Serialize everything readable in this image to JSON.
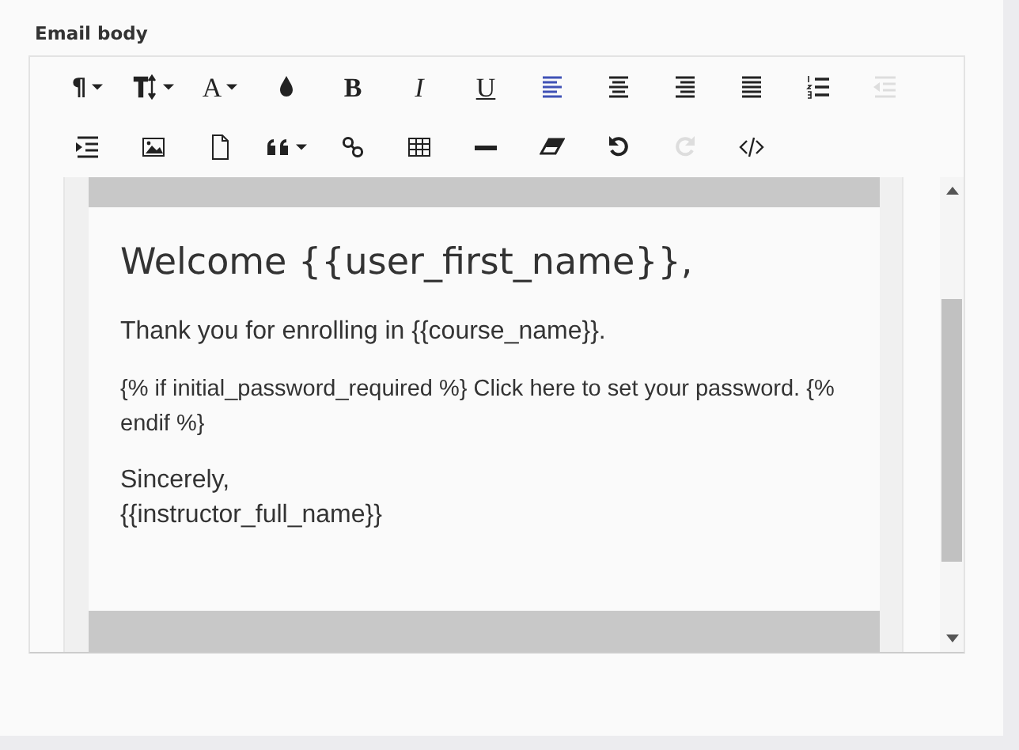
{
  "field": {
    "label": "Email body"
  },
  "toolbar": [
    [
      {
        "kind": "paragraph",
        "glyph": "¶",
        "dropdown": true,
        "selected": false,
        "disabled": false
      },
      {
        "kind": "font-size",
        "dropdown": true,
        "selected": false,
        "disabled": false
      },
      {
        "kind": "font-family",
        "glyph": "A",
        "dropdown": true,
        "selected": false,
        "disabled": false
      },
      {
        "kind": "color",
        "dropdown": false,
        "selected": false,
        "disabled": false
      },
      {
        "kind": "bold",
        "glyph": "B",
        "dropdown": false,
        "selected": false,
        "disabled": false
      },
      {
        "kind": "italic",
        "glyph": "I",
        "dropdown": false,
        "selected": false,
        "disabled": false
      },
      {
        "kind": "underline",
        "glyph": "U",
        "dropdown": false,
        "selected": false,
        "disabled": false
      },
      {
        "kind": "align-left",
        "dropdown": false,
        "selected": true,
        "disabled": false
      },
      {
        "kind": "align-center",
        "dropdown": false,
        "selected": false,
        "disabled": false
      },
      {
        "kind": "align-right",
        "dropdown": false,
        "selected": false,
        "disabled": false
      },
      {
        "kind": "justify",
        "dropdown": false,
        "selected": false,
        "disabled": false
      },
      {
        "kind": "ordered-list",
        "dropdown": false,
        "selected": false,
        "disabled": false
      },
      {
        "kind": "outdent",
        "dropdown": false,
        "selected": false,
        "disabled": true
      }
    ],
    [
      {
        "kind": "indent",
        "dropdown": false,
        "selected": false,
        "disabled": false
      },
      {
        "kind": "image",
        "dropdown": false,
        "selected": false,
        "disabled": false
      },
      {
        "kind": "file",
        "dropdown": false,
        "selected": false,
        "disabled": false
      },
      {
        "kind": "quote",
        "dropdown": true,
        "selected": false,
        "disabled": false
      },
      {
        "kind": "link",
        "dropdown": false,
        "selected": false,
        "disabled": false
      },
      {
        "kind": "table",
        "dropdown": false,
        "selected": false,
        "disabled": false
      },
      {
        "kind": "rule",
        "dropdown": false,
        "selected": false,
        "disabled": false
      },
      {
        "kind": "eraser",
        "dropdown": false,
        "selected": false,
        "disabled": false
      },
      {
        "kind": "undo",
        "dropdown": false,
        "selected": false,
        "disabled": false
      },
      {
        "kind": "redo",
        "dropdown": false,
        "selected": false,
        "disabled": true
      },
      {
        "kind": "code",
        "dropdown": false,
        "selected": false,
        "disabled": false
      }
    ]
  ],
  "email": {
    "heading": "Welcome {{user_first_name}},",
    "paragraphs": [
      "Thank you for enrolling in {{course_name}}.",
      "{% if initial_password_required %} Click here to set your password. {% endif %}",
      "Sincerely,\n{{instructor_full_name}}"
    ]
  }
}
